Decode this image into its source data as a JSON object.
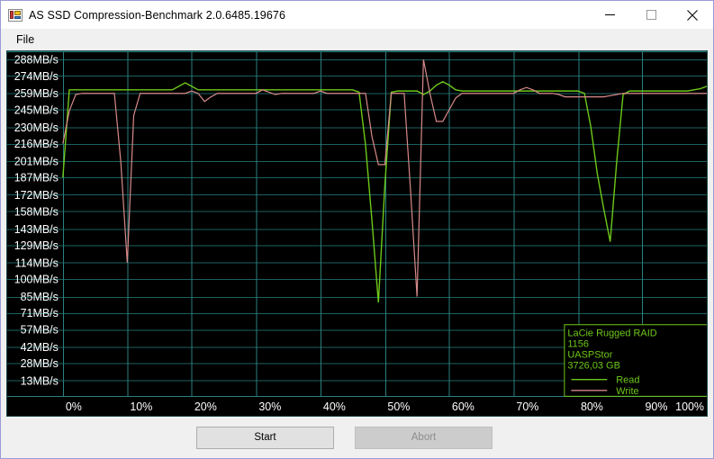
{
  "window": {
    "title": "AS SSD Compression-Benchmark 2.0.6485.19676",
    "icon": "as-ssd-icon",
    "controls": {
      "minimize": "minimize-icon",
      "maximize": "maximize-icon",
      "close": "close-icon"
    }
  },
  "menu": {
    "items": [
      {
        "label": "File"
      }
    ]
  },
  "buttons": {
    "start": {
      "label": "Start",
      "enabled": true
    },
    "abort": {
      "label": "Abort",
      "enabled": false
    }
  },
  "colors": {
    "read": "#6ec819",
    "write": "#d98a8a",
    "plot_background": "#000000",
    "grid": "#1d6060",
    "grid_major": "#2a8080",
    "axis_text": "#ffffff",
    "window_background": "#f0f0f0",
    "titlebar_background": "#ffffff"
  },
  "chart_data": {
    "type": "line",
    "title": "AS SSD Compression-Benchmark",
    "xlabel": "",
    "ylabel": "",
    "grid": true,
    "legend_position": "bottom-right",
    "xlim": [
      0,
      100
    ],
    "ylim": [
      0,
      295
    ],
    "xticks": [
      "0%",
      "10%",
      "20%",
      "30%",
      "40%",
      "50%",
      "60%",
      "70%",
      "80%",
      "90%",
      "100%"
    ],
    "xtick_values": [
      0,
      10,
      20,
      30,
      40,
      50,
      60,
      70,
      80,
      90,
      100
    ],
    "yticks": [
      "288MB/s",
      "274MB/s",
      "259MB/s",
      "245MB/s",
      "230MB/s",
      "216MB/s",
      "201MB/s",
      "187MB/s",
      "172MB/s",
      "158MB/s",
      "143MB/s",
      "129MB/s",
      "114MB/s",
      "100MB/s",
      "85MB/s",
      "71MB/s",
      "57MB/s",
      "42MB/s",
      "28MB/s",
      "13MB/s"
    ],
    "ytick_values": [
      288,
      274,
      259,
      245,
      230,
      216,
      201,
      187,
      172,
      158,
      143,
      129,
      114,
      100,
      85,
      71,
      57,
      42,
      28,
      13
    ],
    "legend": {
      "device_line1": "LaCie Rugged RAID",
      "device_line2": "1156",
      "device_line3": "UASPStor",
      "device_line4": "3726,03 GB",
      "entries": [
        {
          "name": "Read",
          "color": "#6ec819"
        },
        {
          "name": "Write",
          "color": "#d98a8a"
        }
      ]
    },
    "x": [
      0,
      1,
      2,
      3,
      4,
      5,
      6,
      7,
      8,
      9,
      10,
      11,
      12,
      13,
      14,
      15,
      16,
      17,
      18,
      19,
      20,
      21,
      22,
      23,
      24,
      25,
      26,
      27,
      28,
      29,
      30,
      31,
      32,
      33,
      34,
      35,
      36,
      37,
      38,
      39,
      40,
      41,
      42,
      43,
      44,
      45,
      46,
      47,
      48,
      49,
      50,
      51,
      52,
      53,
      54,
      55,
      56,
      57,
      58,
      59,
      60,
      61,
      62,
      63,
      64,
      65,
      66,
      67,
      68,
      69,
      70,
      71,
      72,
      73,
      74,
      75,
      76,
      77,
      78,
      79,
      80,
      81,
      82,
      83,
      84,
      85,
      86,
      87,
      88,
      89,
      90,
      91,
      92,
      93,
      94,
      95,
      96,
      97,
      98,
      99,
      100
    ],
    "series": [
      {
        "name": "Read",
        "color": "#6ec819",
        "values": [
          187,
          262,
          262,
          262,
          262,
          262,
          262,
          262,
          262,
          262,
          262,
          262,
          262,
          262,
          262,
          262,
          262,
          262,
          265,
          268,
          265,
          262,
          262,
          262,
          262,
          262,
          262,
          262,
          262,
          262,
          262,
          262,
          262,
          262,
          262,
          262,
          262,
          262,
          262,
          262,
          262,
          262,
          262,
          262,
          262,
          262,
          260,
          215,
          150,
          80,
          180,
          260,
          261,
          261,
          261,
          261,
          258,
          261,
          266,
          269,
          266,
          262,
          261,
          261,
          261,
          261,
          261,
          261,
          261,
          261,
          261,
          261,
          261,
          261,
          261,
          261,
          261,
          261,
          261,
          261,
          261,
          259,
          230,
          190,
          160,
          132,
          200,
          258,
          261,
          261,
          261,
          261,
          261,
          261,
          261,
          261,
          261,
          261,
          262,
          263,
          265
        ]
      },
      {
        "name": "Write",
        "color": "#d98a8a",
        "values": [
          216,
          244,
          258,
          259,
          259,
          259,
          259,
          259,
          259,
          200,
          114,
          240,
          259,
          259,
          259,
          259,
          259,
          259,
          259,
          259,
          261,
          259,
          252,
          256,
          259,
          259,
          259,
          259,
          259,
          259,
          259,
          262,
          260,
          258,
          259,
          259,
          259,
          259,
          259,
          259,
          261,
          259,
          259,
          259,
          259,
          259,
          259,
          259,
          222,
          198,
          198,
          259,
          259,
          259,
          175,
          85,
          288,
          259,
          235,
          235,
          245,
          255,
          259,
          259,
          259,
          259,
          259,
          259,
          259,
          259,
          259,
          262,
          264,
          262,
          259,
          259,
          259,
          258,
          256,
          256,
          256,
          256,
          256,
          256,
          256,
          257,
          258,
          259,
          259,
          259,
          259,
          259,
          259,
          259,
          259,
          259,
          259,
          259,
          259,
          259,
          259
        ]
      }
    ]
  }
}
